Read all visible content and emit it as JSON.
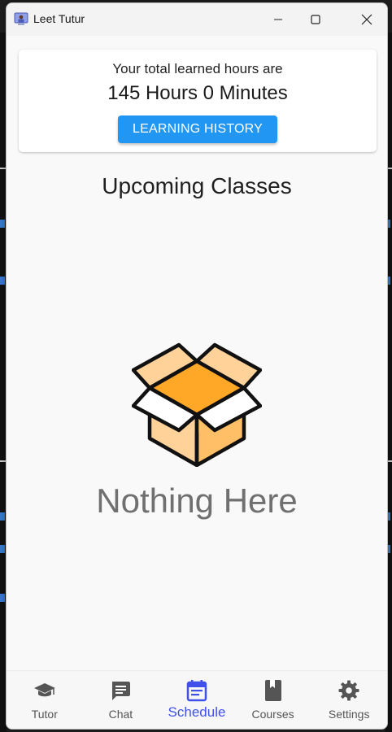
{
  "window": {
    "title": "Leet Tutur"
  },
  "hours_card": {
    "caption": "Your total learned hours are",
    "value": "145 Hours 0 Minutes",
    "history_button": "LEARNING HISTORY"
  },
  "upcoming": {
    "title": "Upcoming Classes",
    "empty_text": "Nothing Here"
  },
  "nav": {
    "items": [
      {
        "label": "Tutor",
        "icon": "graduation-cap-icon"
      },
      {
        "label": "Chat",
        "icon": "chat-icon"
      },
      {
        "label": "Schedule",
        "icon": "calendar-icon",
        "active": true
      },
      {
        "label": "Courses",
        "icon": "book-icon"
      },
      {
        "label": "Settings",
        "icon": "gear-icon"
      }
    ]
  },
  "colors": {
    "accent": "#2196f3",
    "active_nav": "#3f51e8",
    "box_orange": "#ffa726",
    "box_light": "#ffd29a"
  }
}
